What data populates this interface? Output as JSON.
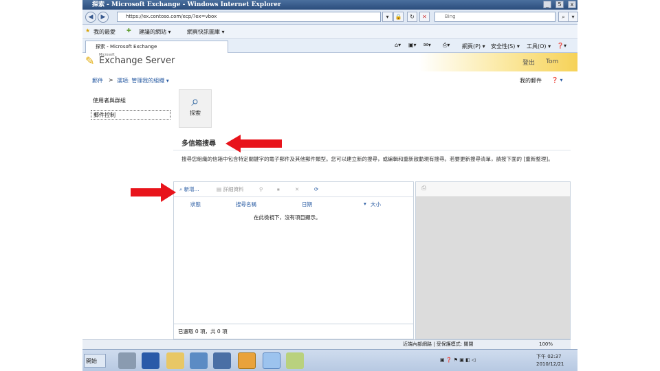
{
  "window": {
    "title": "探索 - Microsoft Exchange - Windows Internet Explorer",
    "min": "_",
    "max": "5",
    "close": "x"
  },
  "browser": {
    "url": "https://ex.contoso.com/ecp/?ex=vbox",
    "search_placeholder": "Bing",
    "favorites_label": "我的最愛",
    "fav_item_1": "建議的網站 ▾",
    "fav_item_2": "網頁快訊圖庫 ▾",
    "tab_label": "探索 - Microsoft Exchange",
    "cmd_page": "網頁(P) ▾",
    "cmd_safety": "安全性(S) ▾",
    "cmd_tools": "工具(O) ▾",
    "cmd_help": "❓▾"
  },
  "exchange": {
    "brand_small": "Microsoft",
    "brand": "Exchange Server",
    "signout": "登出",
    "user": "Tom"
  },
  "breadcrumb": {
    "root": "郵件",
    "sep": ">",
    "current": "選項: 管理我的組織 ▾",
    "myorg": "我的郵件",
    "help": "❓ ▾"
  },
  "leftnav": {
    "items": [
      "使用者與群組",
      "郵件控制"
    ]
  },
  "tile": {
    "label": "探索"
  },
  "section": {
    "title": "多信箱搜尋",
    "desc": "搜尋您組織的信箱中包含特定關鍵字的電子郵件及其他郵件類型。您可以建立新的搜尋，或編輯和重新啟動現有搜尋。若要更新搜尋清單，請按下面的 [重新整理]。"
  },
  "grid": {
    "toolbar": {
      "new": "新增...",
      "details": "詳細資料"
    },
    "columns": [
      "狀態",
      "搜尋名稱",
      "日期",
      "大小"
    ],
    "empty_text": "在此檢視下，沒有項目顯示。",
    "footer": "已選取 0 項，共 0 項"
  },
  "status_bar": {
    "zone": "近端內部網路 | 受保護模式: 關閉",
    "zoom": "100%"
  },
  "taskbar": {
    "start": "開始",
    "time": "下午 02:37",
    "date": "2010/12/21"
  },
  "colors": {
    "arrow": "#e8141b",
    "link": "#2a5ca3"
  }
}
